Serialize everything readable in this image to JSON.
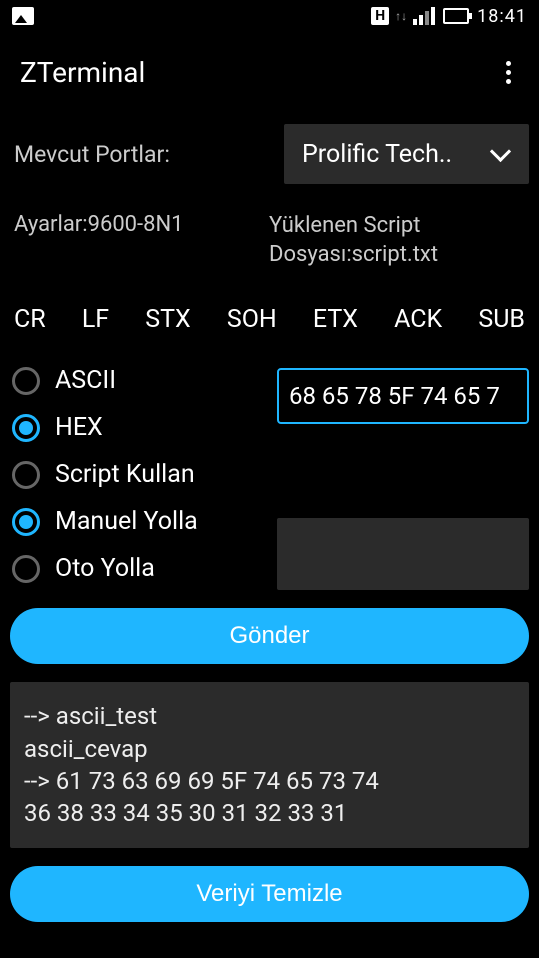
{
  "status": {
    "h_indicator": "H",
    "time": "18:41"
  },
  "app": {
    "title": "ZTerminal"
  },
  "ports": {
    "label": "Mevcut Portlar:",
    "selected": "Prolific Tech.."
  },
  "settings_line": "Ayarlar:9600-8N1",
  "script_line": "Yüklenen Script Dosyası:script.txt",
  "control_chars": [
    "CR",
    "LF",
    "STX",
    "SOH",
    "ETX",
    "ACK",
    "SUB"
  ],
  "format_options": [
    {
      "label": "ASCII",
      "selected": false
    },
    {
      "label": "HEX",
      "selected": true
    },
    {
      "label": "Script Kullan",
      "selected": false
    }
  ],
  "send_options": [
    {
      "label": "Manuel Yolla",
      "selected": true
    },
    {
      "label": "Oto Yolla",
      "selected": false
    }
  ],
  "hex_input_value": "68 65 78 5F 74 65 7",
  "send_button_label": "Gönder",
  "terminal_lines": "--> ascii_test\nascii_cevap\n--> 61 73 63 69 69 5F 74 65 73 74\n 36 38 33 34 35 30 31 32 33 31",
  "clear_button_label": "Veriyi Temizle"
}
